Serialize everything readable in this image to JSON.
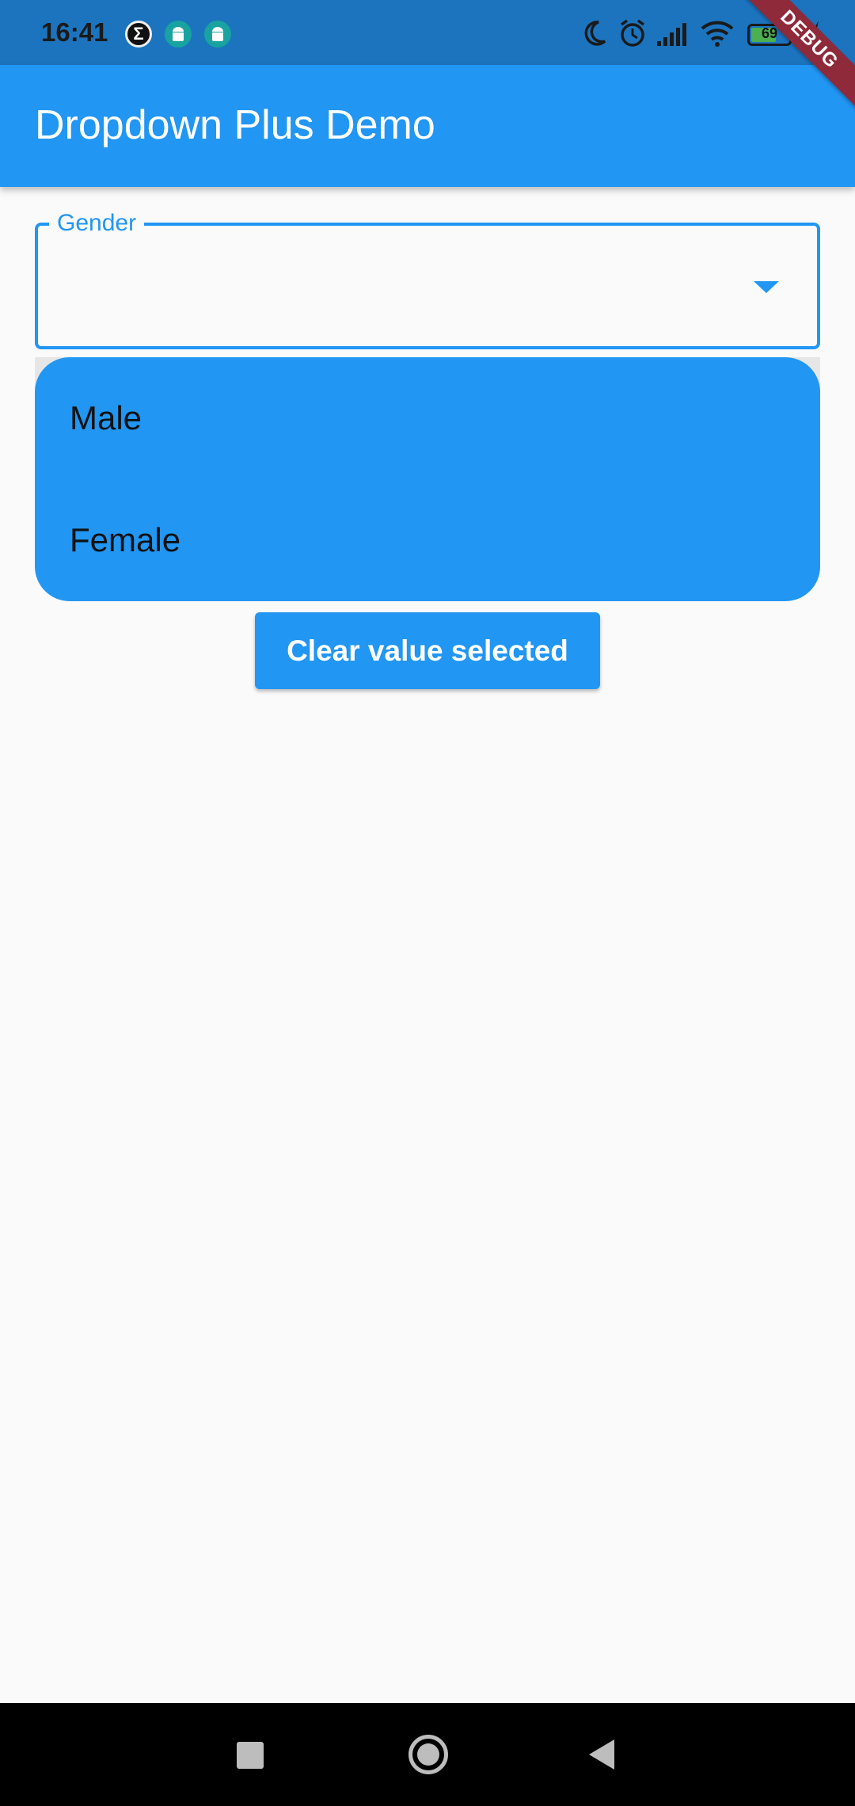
{
  "status_bar": {
    "time": "16:41",
    "battery_level": "69",
    "battery_fraction": 0.69,
    "notification_icons": [
      "sigma-icon",
      "android-icon",
      "android-icon"
    ],
    "system_icons": [
      "moon-icon",
      "alarm-icon",
      "signal-icon",
      "wifi-icon",
      "battery-icon",
      "charging-icon"
    ]
  },
  "debug_banner": "DEBUG",
  "app_bar": {
    "title": "Dropdown Plus Demo",
    "color": "#2196F3"
  },
  "dropdown": {
    "label": "Gender",
    "value": "",
    "options": [
      "Male",
      "Female"
    ],
    "accent_color": "#2196F3"
  },
  "clear_button": {
    "label": "Clear value selected"
  },
  "nav_bar": {
    "buttons": [
      "recents-icon",
      "home-icon",
      "back-icon"
    ]
  }
}
